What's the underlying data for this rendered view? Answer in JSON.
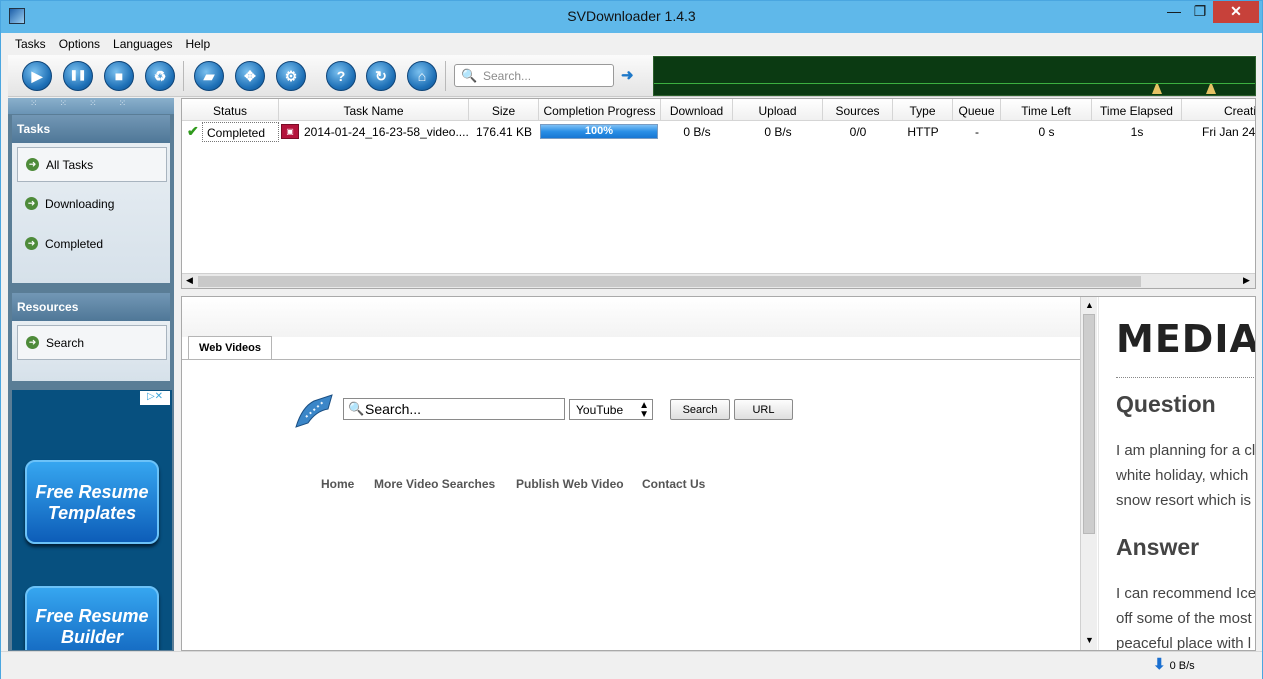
{
  "window": {
    "title": "SVDownloader 1.4.3",
    "minimize": "—",
    "maximize": "❐",
    "close": "✕"
  },
  "menu": [
    "Tasks",
    "Options",
    "Languages",
    "Help"
  ],
  "toolbar": {
    "buttons": [
      {
        "name": "start-icon",
        "glyph": "▶"
      },
      {
        "name": "pause-icon",
        "glyph": "❚❚"
      },
      {
        "name": "stop-icon",
        "glyph": "■"
      },
      {
        "name": "recycle-icon",
        "glyph": "♻"
      },
      {
        "name": "folder-icon",
        "glyph": "▰"
      },
      {
        "name": "fullscreen-icon",
        "glyph": "✥"
      },
      {
        "name": "settings-icon",
        "glyph": "⚙"
      },
      {
        "name": "help-icon",
        "glyph": "?"
      },
      {
        "name": "refresh-icon",
        "glyph": "↻"
      },
      {
        "name": "home-icon",
        "glyph": "⌂"
      }
    ],
    "search_placeholder": "Search...",
    "go_glyph": "➜"
  },
  "sidebar": {
    "tasks_title": "Tasks",
    "task_items": [
      "All Tasks",
      "Downloading",
      "Completed"
    ],
    "resources_title": "Resources",
    "resource_items": [
      "Search"
    ],
    "ad": {
      "choices_label": "▷✕",
      "buttons": [
        [
          "Free Resume",
          "Templates"
        ],
        [
          "Free Resume",
          "Builder"
        ]
      ]
    }
  },
  "tasks": {
    "columns": [
      "Status",
      "Task Name",
      "Size",
      "Completion Progress",
      "Download",
      "Upload",
      "Sources",
      "Type",
      "Queue",
      "Time Left",
      "Time Elapsed",
      "Creati"
    ],
    "rows": [
      {
        "status": "Completed",
        "name": "2014-01-24_16-23-58_video....",
        "size": "176.41 KB",
        "progress": 1.0,
        "progress_label": "100%",
        "download": "0 B/s",
        "upload": "0 B/s",
        "sources": "0/0",
        "type": "HTTP",
        "queue": "-",
        "time_left": "0 s",
        "time_elapsed": "1s",
        "created": "Fri Jan 24"
      }
    ]
  },
  "browser": {
    "tab": "Web Videos",
    "search_placeholder": "Search...",
    "site": "YouTube",
    "search_button": "Search",
    "url_button": "URL",
    "links": [
      "Home",
      "More Video Searches",
      "Publish Web Video",
      "Contact Us"
    ],
    "side_page": {
      "logo": "MEDIAS",
      "question_heading": "Question",
      "question_lines": [
        "I am planning for a cl",
        "white holiday, which",
        "snow resort which is"
      ],
      "answer_heading": "Answer",
      "answer_lines": [
        "I can recommend Ice",
        "off some of the most",
        "peaceful place with l"
      ]
    }
  },
  "status": {
    "speed": "0 B/s"
  }
}
